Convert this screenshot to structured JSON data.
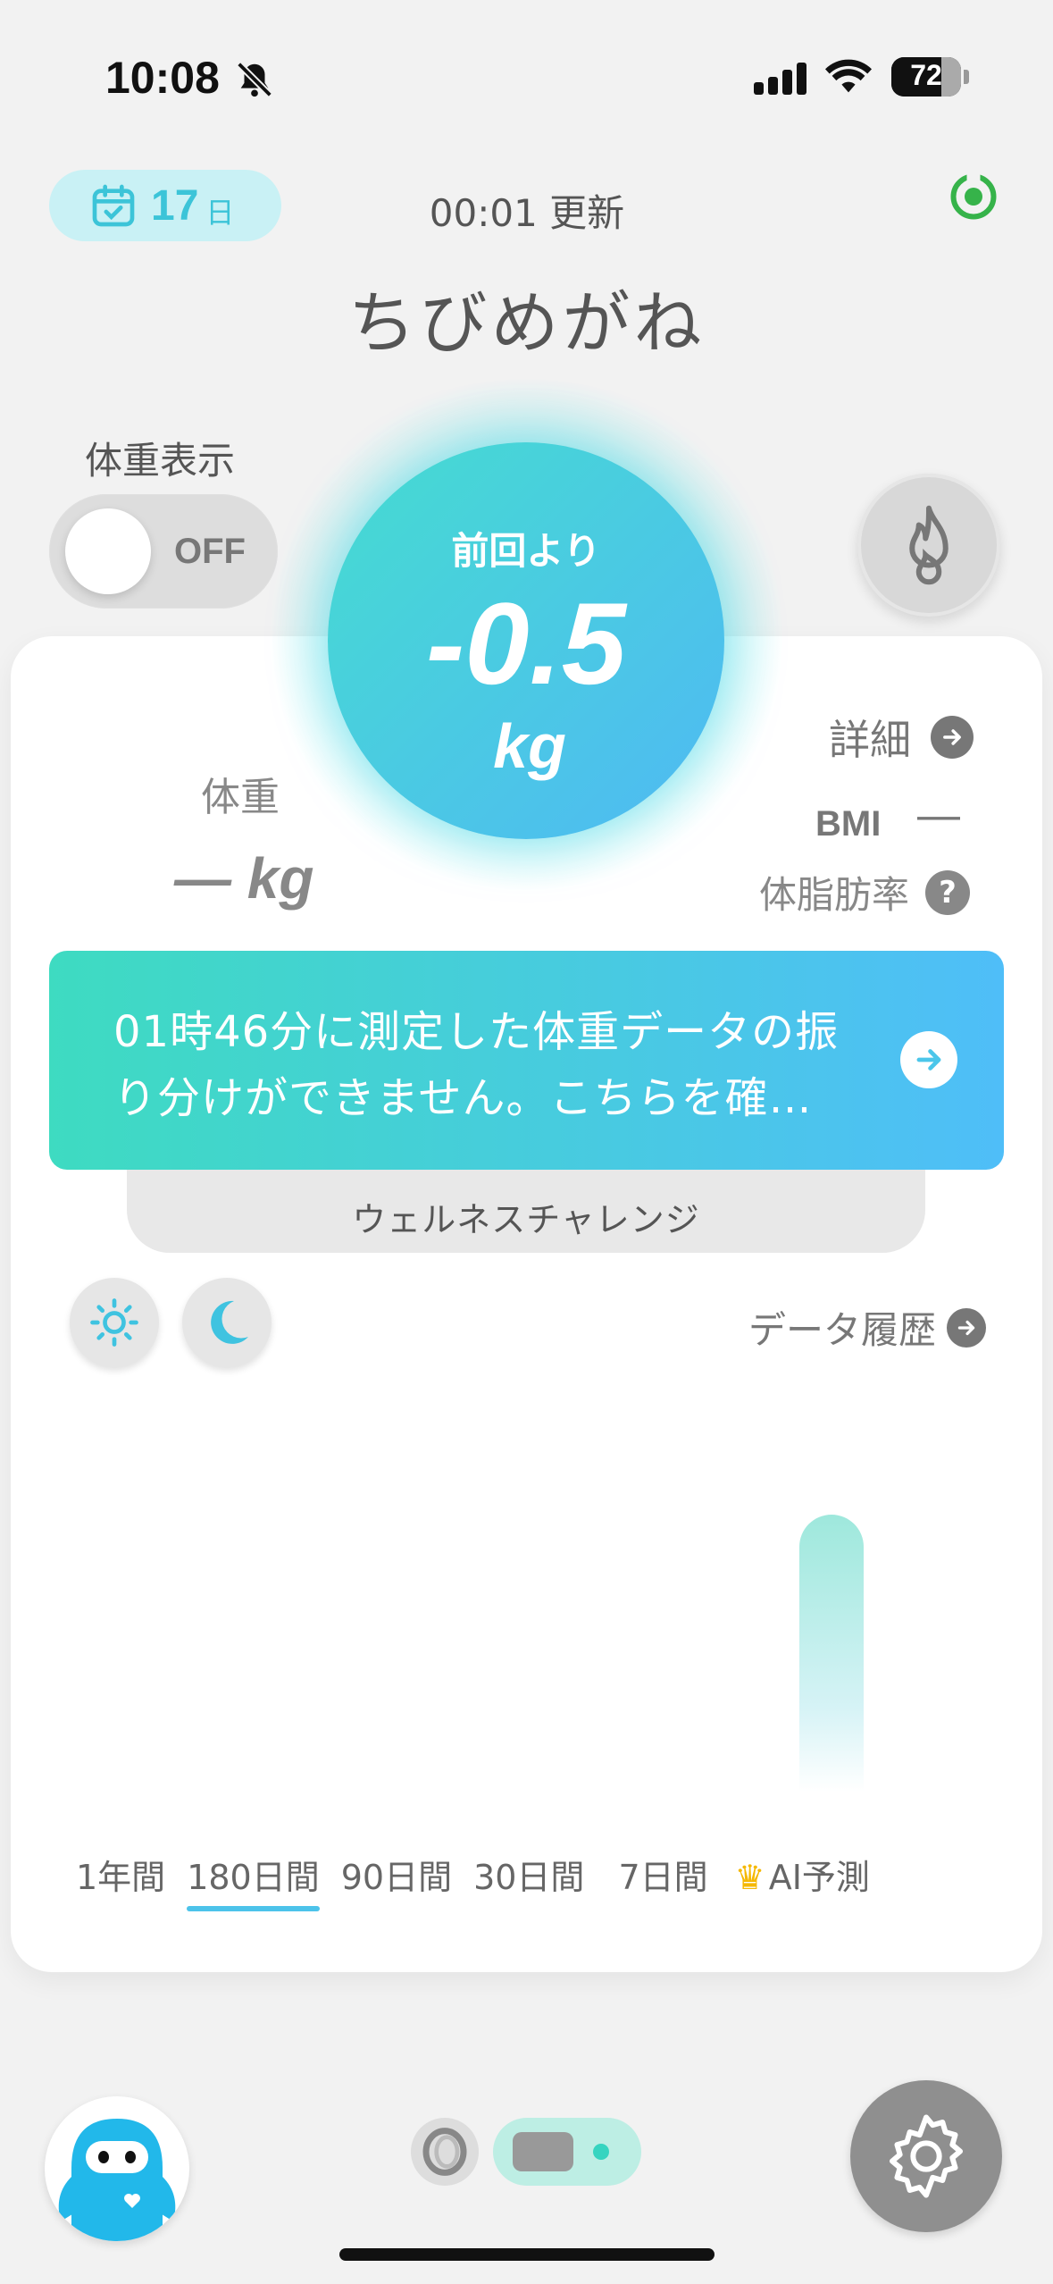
{
  "status_bar": {
    "time": "10:08",
    "battery": "72",
    "battery_level": 0.72
  },
  "header": {
    "days": "17",
    "days_unit": "日",
    "update": "00:01 更新",
    "user_name": "ちびめがね"
  },
  "weight_display": {
    "label": "体重表示",
    "toggle": "OFF"
  },
  "summary": {
    "label": "前回より",
    "value": "-0.5",
    "unit": "kg"
  },
  "weight": {
    "title": "体重",
    "value": "― kg"
  },
  "details": {
    "detail_label": "詳細",
    "bmi_label": "BMI",
    "bmi_value": "―",
    "fat_label": "体脂肪率"
  },
  "banner": {
    "text": "01時46分に測定した体重データの振り分けができません。こちらを確…"
  },
  "wellness": {
    "label": "ウェルネスチャレンジ"
  },
  "history": {
    "label": "データ履歴"
  },
  "periods": [
    "1年間",
    "180日間",
    "90日間",
    "30日間",
    "7日間",
    "AI予測"
  ],
  "active_period": "180日間",
  "colors": {
    "accent": "#4fc8e6",
    "gradient_start": "#3edbc1",
    "gradient_end": "#4fbef8"
  },
  "icons": [
    "calendar-icon",
    "sync-icon",
    "fire-icon",
    "sun-icon",
    "moon-icon",
    "settings-icon",
    "arrow-right-icon",
    "help-icon",
    "crown-icon"
  ]
}
